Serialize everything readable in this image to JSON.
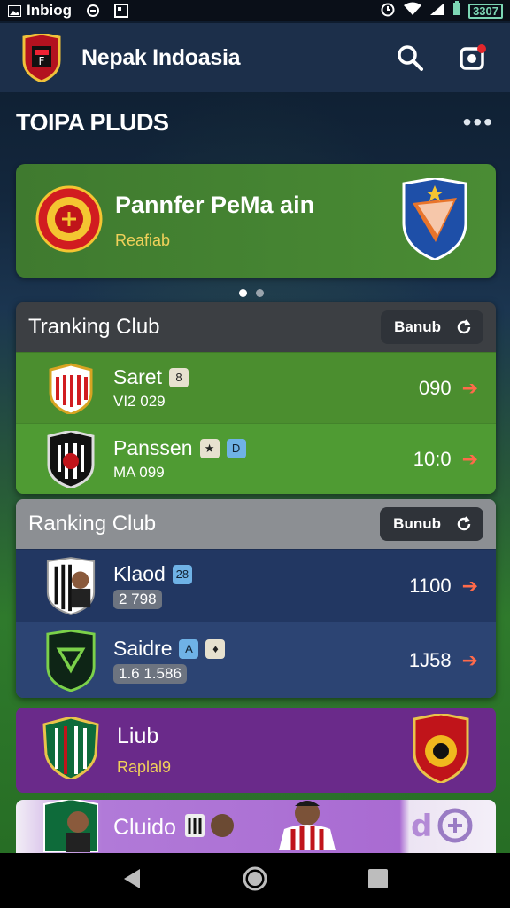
{
  "status_bar": {
    "app_name": "Inbiog",
    "battery": "3307"
  },
  "app_bar": {
    "title": "Nepak Indoasia"
  },
  "section": {
    "title": "TOIPA PLUDS",
    "more": "•••"
  },
  "feature": {
    "name": "Pannfer PeMa ain",
    "sub": "Reafiab"
  },
  "tranking": {
    "title": "Tranking Club",
    "button": "Banub",
    "rows": [
      {
        "name": "Saret",
        "sub": "VI2 029",
        "value": "090"
      },
      {
        "name": "Panssen",
        "sub": "MA 099",
        "value": "10:0"
      }
    ]
  },
  "ranking": {
    "title": "Ranking Club",
    "button": "Bunub",
    "rows": [
      {
        "name": "Klaod",
        "sub": "2 798",
        "value": "1100"
      },
      {
        "name": "Saidre",
        "sub": "1.6 1.586",
        "value": "1J58"
      }
    ]
  },
  "liub": {
    "name": "Liub",
    "sub": "Raplal9"
  },
  "cluido": {
    "name": "Cluido"
  },
  "colors": {
    "accent_green": "#4a8c34",
    "arrow": "#ff6a4a",
    "gold": "#f1d15a",
    "purple": "#6a2a8a",
    "navy": "#243a60"
  }
}
